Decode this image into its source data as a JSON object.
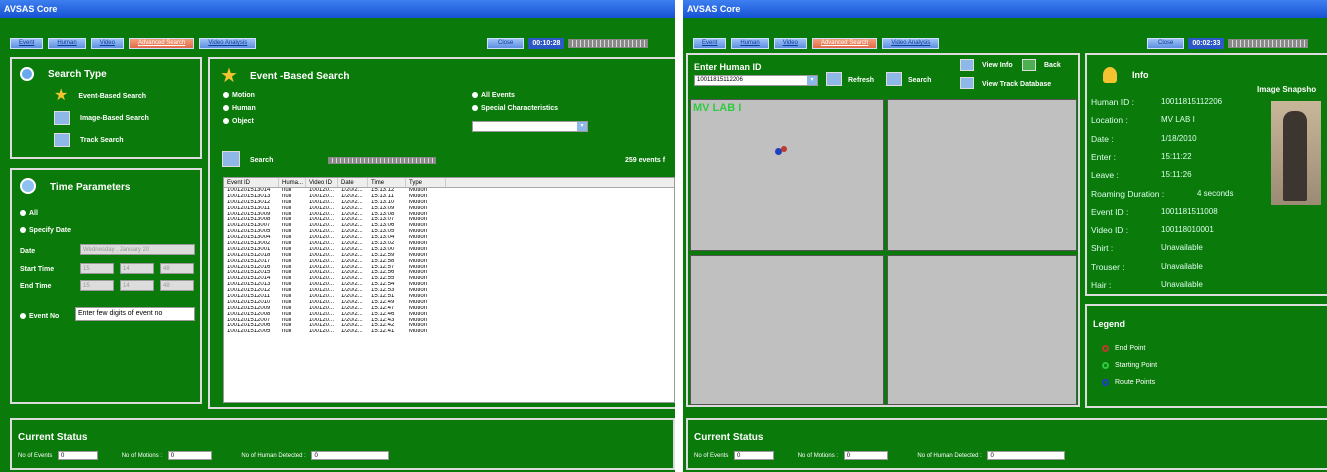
{
  "app_title": "AVSAS Core",
  "menu": [
    "Event",
    "Human",
    "Video",
    "Advanced Search",
    "Video Analysis"
  ],
  "menu_selected": "Advanced Search",
  "close_label": "Close",
  "left": {
    "timer": "00:10:28",
    "search_type": {
      "title": "Search Type",
      "items": [
        "Event-Based Search",
        "Image-Based Search",
        "Track Search"
      ]
    },
    "time_params": {
      "title": "Time Parameters",
      "all": "All",
      "specify_date": "Specify Date",
      "date_label": "Date",
      "date_value": "Wednesday , January 20",
      "start_time_label": "Start Time",
      "start_time": [
        "15",
        "14",
        "48"
      ],
      "end_time_label": "End Time",
      "end_time": [
        "15",
        "14",
        "48"
      ],
      "event_no_label": "Event No",
      "event_no_placeholder": "Enter few digits of event no"
    },
    "event_search": {
      "title": "Event -Based Search",
      "radios": [
        "Motion",
        "Human",
        "Object"
      ],
      "radios_right": [
        "All Events",
        "Special Characteristics"
      ],
      "search_label": "Search",
      "event_count": "259 events f"
    },
    "table": {
      "headers": [
        "Event ID",
        "Huma...",
        "Video ID",
        "Date",
        "Time",
        "Type"
      ],
      "rows": [
        [
          "1001201513014",
          "null",
          "100120...",
          "1/20/2...",
          "15:13:12",
          "Motion"
        ],
        [
          "1001201513013",
          "null",
          "100120...",
          "1/20/2...",
          "15:13:11",
          "Motion"
        ],
        [
          "1001201513012",
          "null",
          "100120...",
          "1/20/2...",
          "15:13:10",
          "Motion"
        ],
        [
          "1001201513011",
          "null",
          "100120...",
          "1/20/2...",
          "15:13:09",
          "Motion"
        ],
        [
          "1001201513009",
          "null",
          "100120...",
          "1/20/2...",
          "15:13:08",
          "Motion"
        ],
        [
          "1001201513008",
          "null",
          "100120...",
          "1/20/2...",
          "15:13:07",
          "Motion"
        ],
        [
          "1001201513007",
          "null",
          "100120...",
          "1/20/2...",
          "15:13:06",
          "Motion"
        ],
        [
          "1001201513005",
          "null",
          "100120...",
          "1/20/2...",
          "15:13:05",
          "Motion"
        ],
        [
          "1001201513004",
          "null",
          "100120...",
          "1/20/2...",
          "15:13:04",
          "Motion"
        ],
        [
          "1001201513002",
          "null",
          "100120...",
          "1/20/2...",
          "15:13:02",
          "Motion"
        ],
        [
          "1001201513001",
          "null",
          "100120...",
          "1/20/2...",
          "15:13:00",
          "Motion"
        ],
        [
          "1001201512018",
          "null",
          "100120...",
          "1/20/2...",
          "15:12:59",
          "Motion"
        ],
        [
          "1001201512017",
          "null",
          "100120...",
          "1/20/2...",
          "15:12:58",
          "Motion"
        ],
        [
          "1001201512016",
          "null",
          "100120...",
          "1/20/2...",
          "15:12:57",
          "Motion"
        ],
        [
          "1001201512015",
          "null",
          "100120...",
          "1/20/2...",
          "15:12:56",
          "Motion"
        ],
        [
          "1001201512014",
          "null",
          "100120...",
          "1/20/2...",
          "15:12:55",
          "Motion"
        ],
        [
          "1001201512013",
          "null",
          "100120...",
          "1/20/2...",
          "15:12:54",
          "Motion"
        ],
        [
          "1001201512012",
          "null",
          "100120...",
          "1/20/2...",
          "15:12:53",
          "Motion"
        ],
        [
          "1001201512011",
          "null",
          "100120...",
          "1/20/2...",
          "15:12:51",
          "Motion"
        ],
        [
          "1001201512010",
          "null",
          "100120...",
          "1/20/2...",
          "15:12:49",
          "Motion"
        ],
        [
          "1001201512009",
          "null",
          "100120...",
          "1/20/2...",
          "15:12:47",
          "Motion"
        ],
        [
          "1001201512008",
          "null",
          "100120...",
          "1/20/2...",
          "15:12:46",
          "Motion"
        ],
        [
          "1001201512007",
          "null",
          "100120...",
          "1/20/2...",
          "15:12:43",
          "Motion"
        ],
        [
          "1001201512006",
          "null",
          "100120...",
          "1/20/2...",
          "15:12:42",
          "Motion"
        ],
        [
          "1001201512005",
          "null",
          "100120...",
          "1/20/2...",
          "15:12:41",
          "Motion"
        ]
      ]
    },
    "status": {
      "title": "Current Status",
      "events_label": "No of Events",
      "events_value": "0",
      "motions_label": "No of Motions :",
      "motions_value": "0",
      "humans_label": "No of Human Detected :",
      "humans_value": "0"
    }
  },
  "right": {
    "timer": "00:02:33",
    "enter_human_id": "Enter Human ID",
    "human_id_value": "10011815112206",
    "refresh_label": "Refresh",
    "search_label": "Search",
    "view_info_label": "View Info",
    "back_label": "Back",
    "view_track_label": "View Track Database",
    "video_label": "MV LAB I",
    "info": {
      "title": "Info",
      "snapshot_label": "Image Snapsho",
      "rows": [
        [
          "Human ID :",
          "10011815112206"
        ],
        [
          "Location :",
          "MV LAB I"
        ],
        [
          "Date :",
          "1/18/2010"
        ],
        [
          "Enter :",
          "15:11:22"
        ],
        [
          "Leave :",
          "15:11:26"
        ],
        [
          "Roaming Duration :",
          "4 seconds"
        ],
        [
          "Event ID :",
          "1001181511008"
        ],
        [
          "Video ID :",
          "100118010001"
        ],
        [
          "Shirt :",
          "Unavailable"
        ],
        [
          "Trouser :",
          "Unavailable"
        ],
        [
          "Hair :",
          "Unavailable"
        ]
      ]
    },
    "legend": {
      "title": "Legend",
      "items": [
        {
          "label": "End Point",
          "color": "#c0392b"
        },
        {
          "label": "Starting Point",
          "color": "#2ecc40"
        },
        {
          "label": "Route Points",
          "color": "#1f3fbf"
        }
      ]
    },
    "status": {
      "title": "Current Status",
      "events_label": "No of Events",
      "events_value": "0",
      "motions_label": "No of Motions :",
      "motions_value": "0",
      "humans_label": "No of Human Detected :",
      "humans_value": "0"
    }
  }
}
